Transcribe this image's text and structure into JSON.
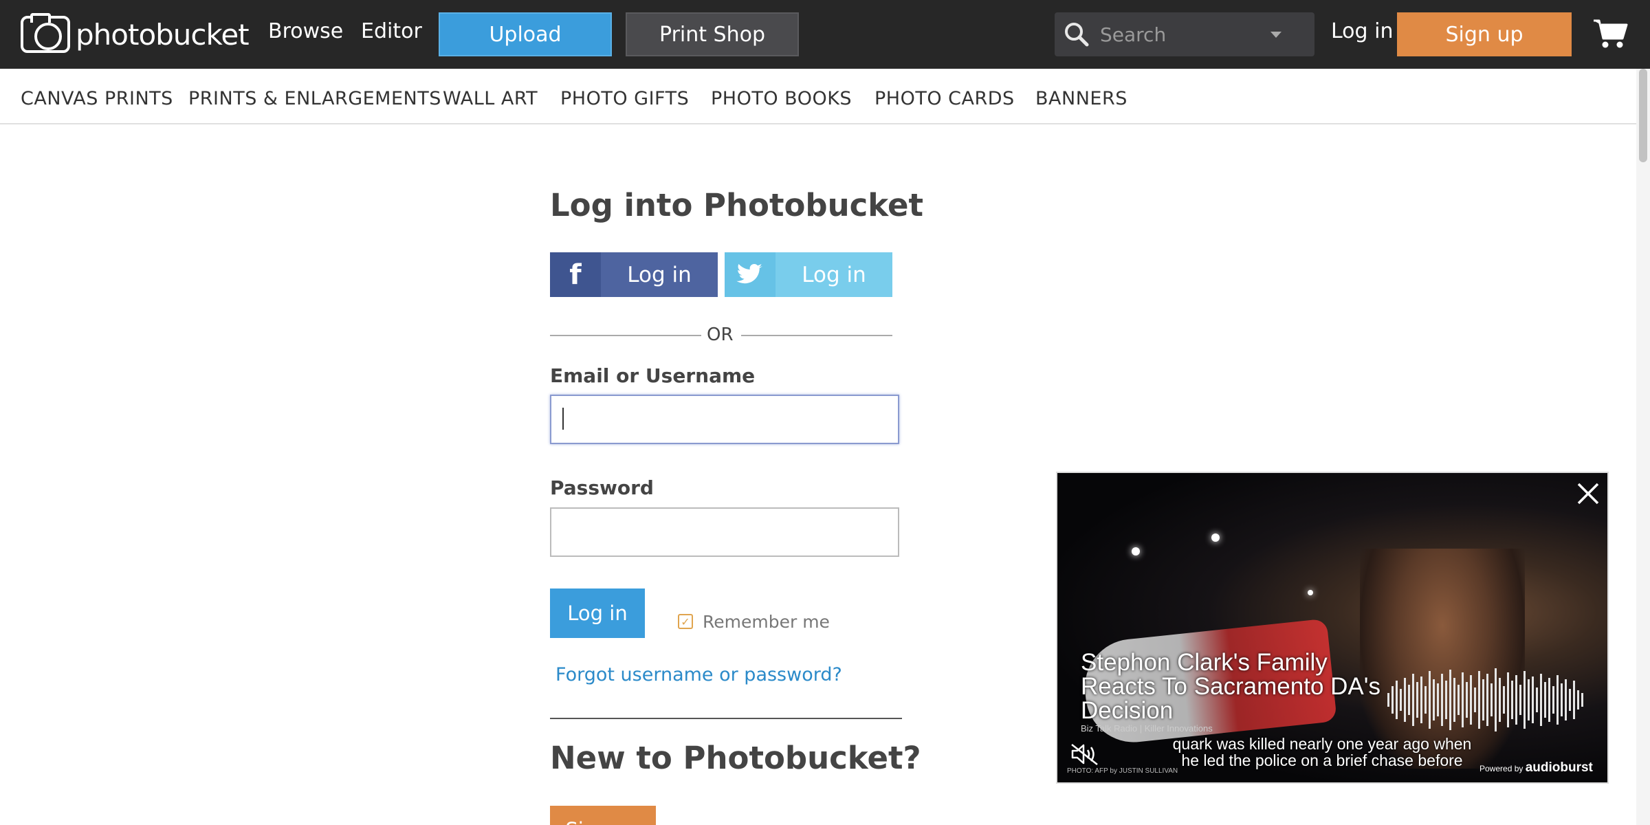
{
  "header": {
    "logo_text": "photobucket",
    "nav": {
      "browse": "Browse",
      "editor": "Editor"
    },
    "upload_label": "Upload",
    "print_shop_label": "Print Shop",
    "search_placeholder": "Search",
    "login_label": "Log in",
    "signup_label": "Sign up"
  },
  "subnav": {
    "items": [
      "CANVAS PRINTS",
      "PRINTS & ENLARGEMENTS",
      "WALL ART",
      "PHOTO GIFTS",
      "PHOTO BOOKS",
      "PHOTO CARDS",
      "BANNERS"
    ]
  },
  "login": {
    "title": "Log into Photobucket",
    "facebook_label": "Log in",
    "twitter_label": "Log in",
    "or_text": "OR",
    "email_label": "Email or Username",
    "email_value": "",
    "password_label": "Password",
    "password_value": "",
    "submit_label": "Log in",
    "remember_label": "Remember me",
    "remember_checked": true,
    "forgot_label": "Forgot username or password?",
    "new_title": "New to Photobucket?",
    "signup_label": "Sign up"
  },
  "video": {
    "title": "Stephon Clark's Family Reacts To Sacramento DA's Decision",
    "source": "Biz Talk Radio | Killer Innovations",
    "caption": "quark was killed nearly one year ago when he led the police on a brief chase before",
    "photo_credit": "PHOTO: AFP by JUSTIN SULLIVAN",
    "powered_by_prefix": "Powered by",
    "powered_by_brand": "audioburst"
  },
  "colors": {
    "topbar": "#272727",
    "upload": "#3b9ddc",
    "signup": "#e08a45",
    "facebook": "#4e64a0",
    "twitter": "#79cdec",
    "link": "#2b8ac9"
  },
  "icons": {
    "logo": "camera-logo-icon",
    "search": "search-icon",
    "cart": "cart-icon",
    "facebook": "facebook-icon",
    "twitter": "twitter-icon",
    "checkbox": "checkmark-icon",
    "close": "close-icon",
    "mute": "mute-icon"
  }
}
